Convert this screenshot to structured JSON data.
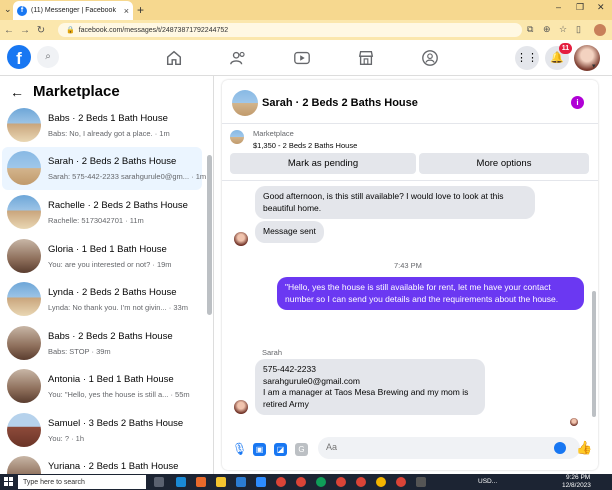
{
  "browser": {
    "tab_title": "(11) Messenger | Facebook",
    "tab_favicon_letter": "f",
    "url": "facebook.com/messages/t/24873871792244752"
  },
  "fb_nav": {
    "logo_letter": "f",
    "notification_count": "11"
  },
  "sidebar": {
    "title": "Marketplace",
    "conversations": [
      {
        "name": "Babs · 2 Beds 1 Bath House",
        "snippet": "Babs: No, I already got a place. · 1m",
        "photo": "house",
        "active": false
      },
      {
        "name": "Sarah · 2 Beds 2 Baths House",
        "snippet": "Sarah: 575-442-2233 sarahgurule0@gm... · 1m",
        "photo": "house",
        "active": true
      },
      {
        "name": "Rachelle · 2 Beds 2 Baths House",
        "snippet": "Rachelle: 5173042701 · 11m",
        "photo": "house",
        "active": false
      },
      {
        "name": "Gloria · 1 Bed 1 Bath House",
        "snippet": "You: are you interested or not? · 19m",
        "photo": "room",
        "active": false
      },
      {
        "name": "Lynda · 2 Beds 2 Baths House",
        "snippet": "Lynda: No thank you. I'm not givin... · 33m",
        "photo": "house",
        "active": false
      },
      {
        "name": "Babs · 2 Beds 2 Baths House",
        "snippet": "Babs: STOP · 39m",
        "photo": "room",
        "active": false
      },
      {
        "name": "Antonia · 1 Bed 1 Bath House",
        "snippet": "You: \"Hello, yes the house is still a... · 55m",
        "photo": "room",
        "active": false
      },
      {
        "name": "Samuel · 3 Beds 2 Baths House",
        "snippet": "You: ? · 1h",
        "photo": "brick",
        "active": false
      },
      {
        "name": "Yuriana · 2 Beds 1 Bath House",
        "snippet": "",
        "photo": "room",
        "active": false
      }
    ]
  },
  "chat": {
    "title": "Sarah · 2 Beds 2 Baths House",
    "marketplace_label": "Marketplace",
    "listing": "$1,350 - 2 Beds 2 Baths House",
    "mark_pending_label": "Mark as pending",
    "more_options_label": "More options",
    "messages": {
      "in_1": "Good afternoon, is this still available? I would love to look at this beautiful home.",
      "in_2": "Message sent",
      "timestamp": "7:43 PM",
      "out_1": "\"Hello, yes the house is still available for rent, let me have your contact number so I can send you details and the requirements about the house.",
      "sender_name": "Sarah",
      "in_3_line1": "575-442-2233",
      "in_3_line2": "sarahgurule0@gmail.com",
      "in_3_line3": "I am a manager at Taos Mesa Brewing and my mom is retired Army"
    },
    "composer_placeholder": "Aa"
  },
  "taskbar": {
    "search_placeholder": "Type here to search",
    "tray_currency": "USD...",
    "time": "9:26 PM",
    "date": "12/8/2023"
  },
  "colors": {
    "fb_blue": "#1877f2",
    "outgoing_bubble": "#6b38f2",
    "badge_red": "#e41e3f",
    "browser_tabstrip": "#f6d88f"
  }
}
